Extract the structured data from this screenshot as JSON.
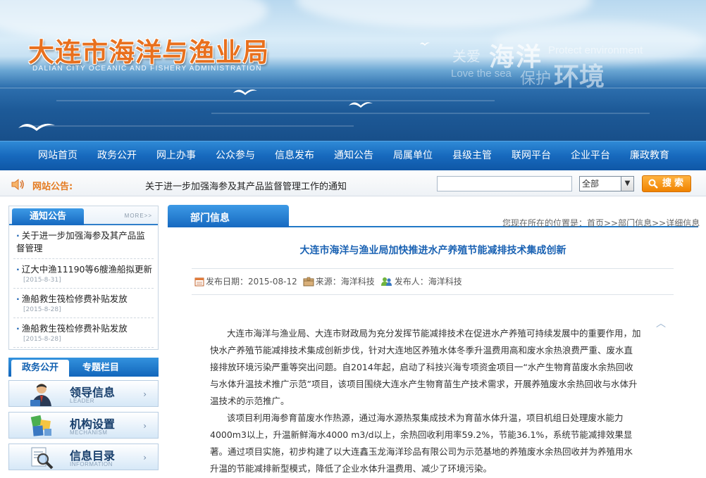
{
  "header": {
    "title": "大连市海洋与渔业局",
    "subtitle": "DALIAN CITY OCEANIC AND FISHERY ADMINISTRATION",
    "slogan": {
      "cn_small": "关爱",
      "cn_big": "海洋",
      "en1": "Protect environment",
      "en2": "Love the sea",
      "cn_small2": "保护",
      "cn_big2": "环境"
    }
  },
  "nav": {
    "items": [
      "网站首页",
      "政务公开",
      "网上办事",
      "公众参与",
      "信息发布",
      "通知公告",
      "局属单位",
      "县级主管",
      "联网平台",
      "企业平台",
      "廉政教育"
    ]
  },
  "notice_bar": {
    "label": "网站公告:",
    "text": "关于进一步加强海参及其产品监督管理工作的通知",
    "search_value": "",
    "select_value": "全部",
    "search_button": "搜索"
  },
  "sidebar": {
    "notice_title": "通知公告",
    "more": "MORE>>",
    "notices": [
      {
        "title": "关于进一步加强海参及其产品监督管理",
        "date": ""
      },
      {
        "title": "辽大中渔11190等6艘渔船拟更新",
        "date": "[2015-8-31]"
      },
      {
        "title": "渔船救生筏检修费补贴发放",
        "date": "[2015-8-28]"
      },
      {
        "title": "渔船救生筏检修费补贴发放",
        "date": "[2015-8-28]"
      }
    ],
    "tabs": [
      "政务公开",
      "专题栏目"
    ],
    "buttons": [
      {
        "cn": "领导信息",
        "en": "LEADER",
        "icon": "person-icon"
      },
      {
        "cn": "机构设置",
        "en": "MECHANISM",
        "icon": "org-chart-icon"
      },
      {
        "cn": "信息目录",
        "en": "INFORMATION",
        "icon": "magnifier-doc-icon"
      }
    ]
  },
  "main": {
    "section_title": "部门信息",
    "breadcrumb": "您现在所在的位置是：首页>>部门信息>>详细信息",
    "article": {
      "title": "大连市海洋与渔业局加快推进水产养殖节能减排技术集成创新",
      "date_label": "发布日期：2015-08-12",
      "source_label": "来源：海洋科技",
      "publisher_label": "发布人：海洋科技",
      "paragraphs": [
        "大连市海洋与渔业局、大连市财政局为充分发挥节能减排技术在促进水产养殖可持续发展中的重要作用，加快水产养殖节能减排技术集成创新步伐，针对大连地区养殖水体冬季升温费用高和废水余热浪费严重、废水直接排放环境污染严重等突出问题。自2014年起，启动了科技兴海专项资金项目一“水产生物育苗废水余热回收与水体升温技术推广示范”项目，该项目围绕大连水产生物育苗生产技术需求，开展养殖废水余热回收与水体升温技术的示范推广。",
        "该项目利用海参育苗废水作热源，通过海水源热泵集成技术为育苗水体升温，项目机组日处理废水能力4000m3以上，升温新鲜海水4000 m3/d以上，余热回收利用率59.2%，节能36.1%，系统节能减排效果显著。通过项目实施，初步构建了以大连鑫玉龙海洋珍品有限公司为示范基地的养殖废水余热回收并为养殖用水升温的节能减排新型模式，降低了企业水体升温费用、减少了环境污染。"
      ]
    }
  },
  "colors": {
    "nav_blue": "#1769bd",
    "title_orange": "#e8701e",
    "link_blue": "#1a62b3",
    "button_orange": "#f08300"
  }
}
